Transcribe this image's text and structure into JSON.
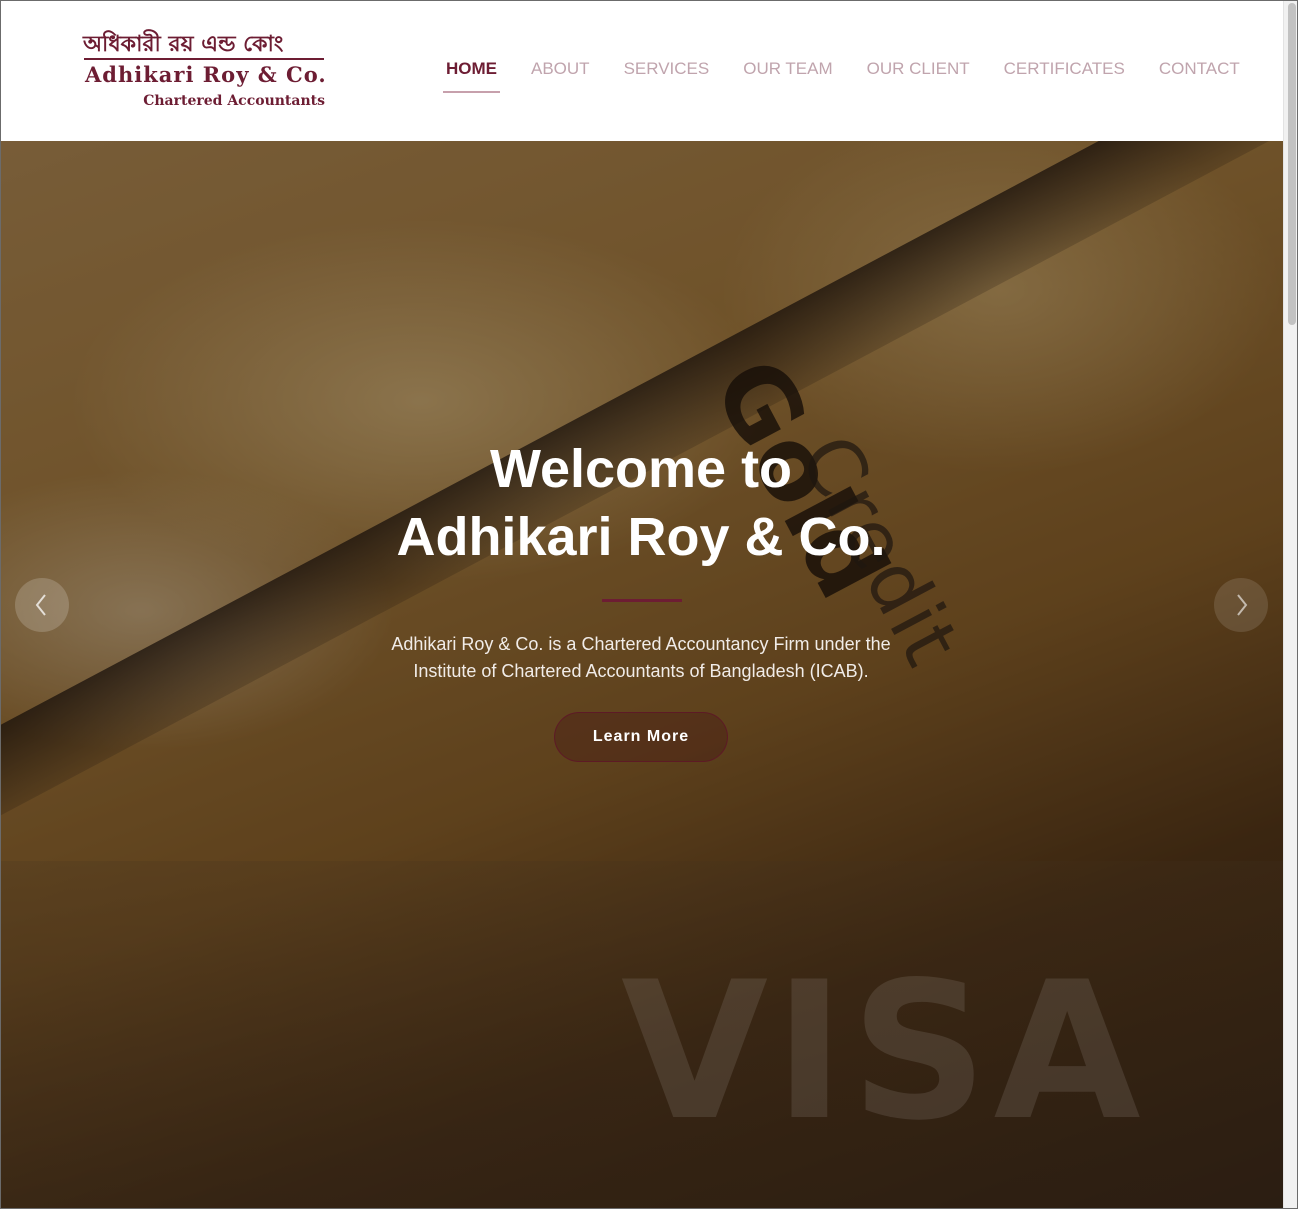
{
  "brand": {
    "name_bengali": "অধিকারী রয় এন্ড কোং",
    "name_english": "Adhikari Roy & Co.",
    "tagline": "Chartered Accountants",
    "color": "#6d1d33"
  },
  "nav": {
    "items": [
      {
        "label": "HOME",
        "active": true
      },
      {
        "label": "ABOUT",
        "active": false
      },
      {
        "label": "SERVICES",
        "active": false
      },
      {
        "label": "OUR TEAM",
        "active": false
      },
      {
        "label": "OUR CLIENT",
        "active": false
      },
      {
        "label": "CERTIFICATES",
        "active": false
      },
      {
        "label": "CONTACT",
        "active": false
      }
    ]
  },
  "hero": {
    "title_line1": "Welcome to",
    "title_line2": "Adhikari Roy & Co.",
    "description_line1": "Adhikari Roy & Co. is a Chartered Accountancy Firm under the",
    "description_line2": "Institute of Chartered Accountants of Bangladesh (ICAB).",
    "button_label": "Learn More",
    "background_words": {
      "credit": "Credit",
      "gold": "Gold",
      "visa": "VISA"
    },
    "prev_icon": "chevron-left-icon",
    "next_icon": "chevron-right-icon"
  }
}
